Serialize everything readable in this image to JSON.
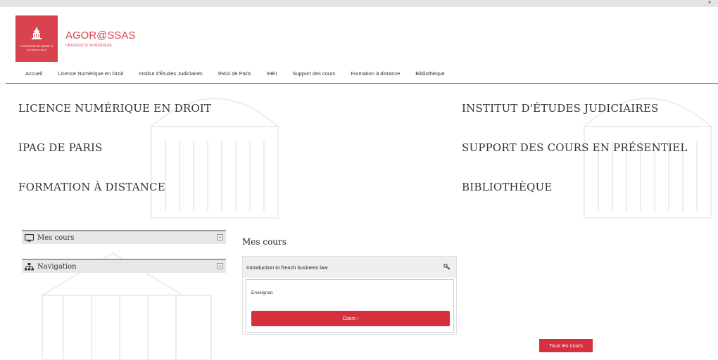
{
  "header": {
    "logo_text": "UNIVERSITÉ PARIS II",
    "logo_sub": "PANTHÉON-ASSAS",
    "brand_name": "AGOR@SSAS",
    "brand_sub": "UNIVERSITÉ NUMÉRIQUE"
  },
  "nav": {
    "items": [
      {
        "label": "Accueil"
      },
      {
        "label": "Licence Numérique en Droit"
      },
      {
        "label": "Institut d'Études Judiciaires"
      },
      {
        "label": "IPAG de Paris"
      },
      {
        "label": "IHEI"
      },
      {
        "label": "Support des cours"
      },
      {
        "label": "Formation à distance"
      },
      {
        "label": "Bibliothèque"
      }
    ]
  },
  "categories": {
    "licence": "LICENCE NUMÉRIQUE EN DROIT",
    "ipag": "IPAG DE PARIS",
    "formation": "FORMATION À DISTANCE",
    "institut": "INSTITUT D'ÉTUDES JUDICIAIRES",
    "support": "SUPPORT DES COURS EN PRÉSENTIEL",
    "bibliotheque": "BIBLIOTHÈQUE"
  },
  "blocks": {
    "mes_cours": "Mes cours",
    "navigation": "Navigation",
    "plus_glyph": "+"
  },
  "main": {
    "title": "Mes cours",
    "course": {
      "title": "Introduction to french business law",
      "teacher": "Enseignan",
      "button": "Cours ›"
    },
    "all_courses_button": "Tous les cours"
  },
  "icons": {
    "monitor": "monitor-icon",
    "sitemap": "sitemap-icon",
    "key": "key-icon",
    "expand": "expand-icon"
  },
  "colors": {
    "accent": "#d9434e",
    "button": "#d4303d"
  }
}
